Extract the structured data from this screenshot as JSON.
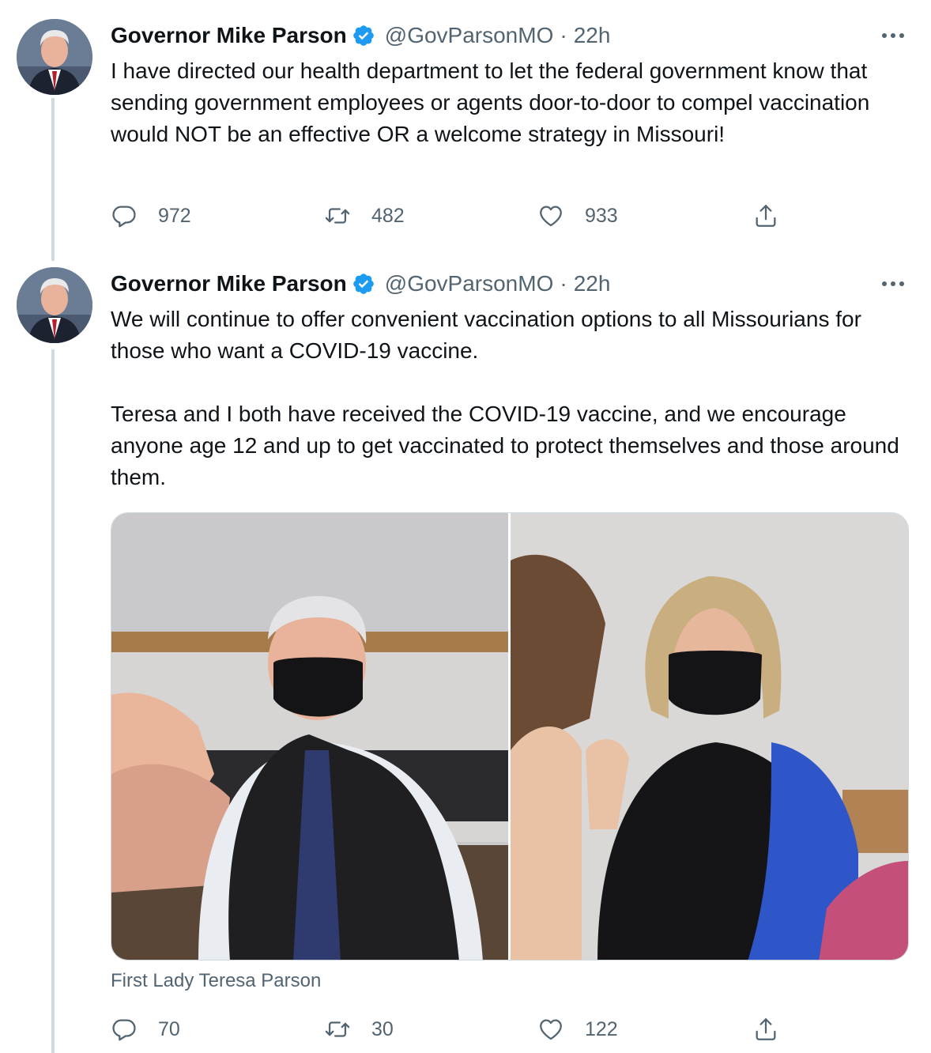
{
  "tweets": [
    {
      "author": {
        "display_name": "Governor Mike Parson",
        "handle": "@GovParsonMO",
        "verified_icon": "verified-badge-icon",
        "avatar_icon": "avatar-photo"
      },
      "separator": "·",
      "time": "22h",
      "text": [
        "I have directed our health department to let the federal government know that sending government employees or agents door-to-door to compel vaccination would NOT be an effective OR a welcome strategy in Missouri!"
      ],
      "actions": {
        "replies": "972",
        "retweets": "482",
        "likes": "933"
      }
    },
    {
      "author": {
        "display_name": "Governor Mike Parson",
        "handle": "@GovParsonMO",
        "verified_icon": "verified-badge-icon",
        "avatar_icon": "avatar-photo"
      },
      "separator": "·",
      "time": "22h",
      "text": [
        "We will continue to offer convenient vaccination options to all Missourians for those who want a COVID-19 vaccine.",
        "Teresa and I both have received the COVID-19 vaccine, and we encourage anyone age 12 and up to get vaccinated to protect themselves and those around them."
      ],
      "media": {
        "photos": [
          "governor-receiving-vaccine",
          "first-lady-receiving-vaccine"
        ],
        "caption": "First Lady Teresa Parson"
      },
      "actions": {
        "replies": "70",
        "retweets": "30",
        "likes": "122"
      }
    }
  ],
  "icons": {
    "more": "more-options-icon",
    "reply": "reply-icon",
    "retweet": "retweet-icon",
    "like": "heart-icon",
    "share": "share-icon"
  },
  "colors": {
    "text": "#0f1419",
    "secondary": "#536471",
    "verified": "#1d9bf0",
    "thread_line": "#cfd9de"
  }
}
